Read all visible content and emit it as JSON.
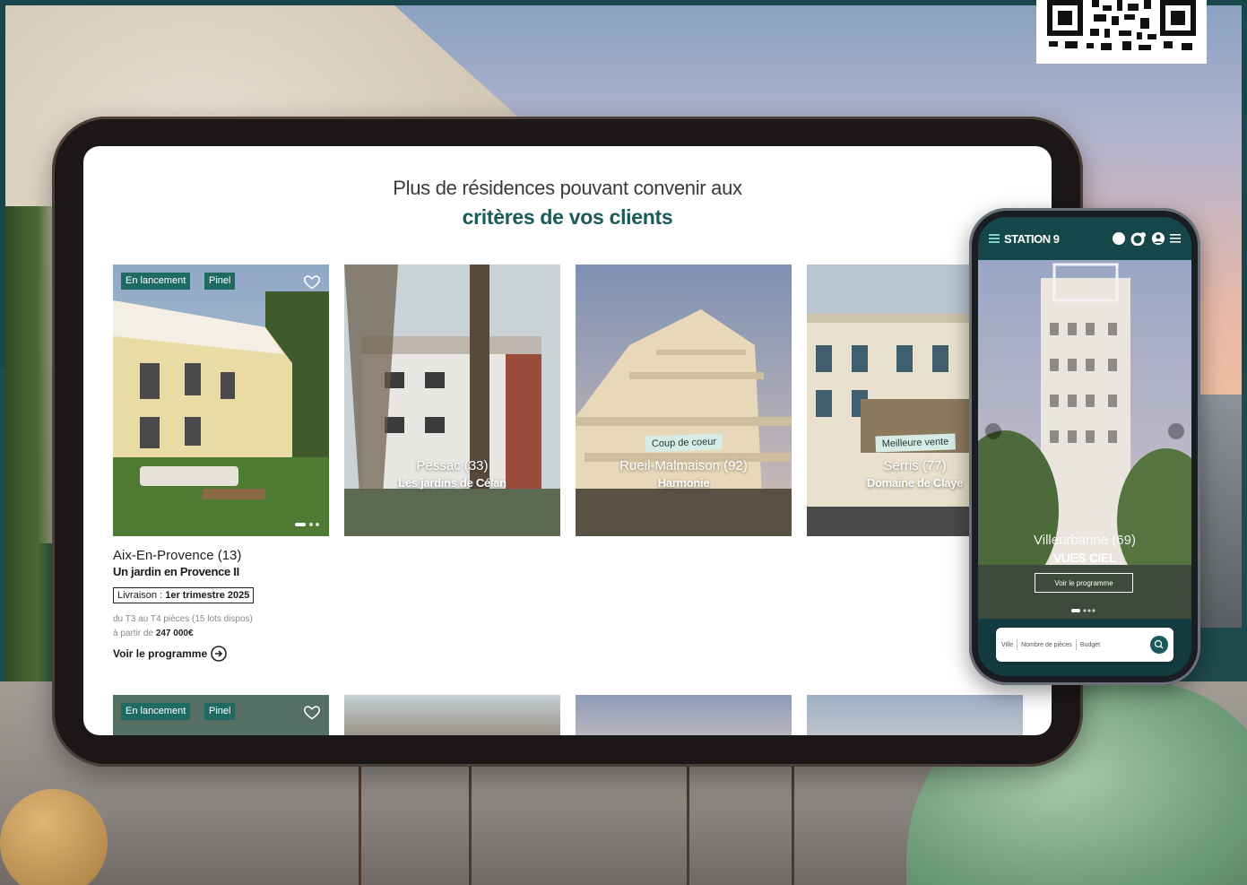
{
  "section": {
    "heading_line1": "Plus de résidences pouvant convenir aux",
    "heading_line2": "critères de vos clients"
  },
  "cards": [
    {
      "tags": [
        "En lancement",
        "Pinel"
      ],
      "city": "Aix-En-Provence (13)",
      "name": "Un jardin en Provence II",
      "delivery_label": "Livraison : ",
      "delivery_value": "1er trimestre 2025",
      "rooms": "du T3 au T4 pièces (15 lots dispos)",
      "price_prefix": "à partir de ",
      "price": "247 000€",
      "cta": "Voir le programme"
    },
    {
      "city": "Pessac (33)",
      "name": "Les jardins de Célan"
    },
    {
      "badge": "Coup de coeur",
      "city": "Rueil-Malmaison (92)",
      "name": "Harmonie"
    },
    {
      "badge": "Meilleure vente",
      "city": "Serris (77)",
      "name": "Domaine de Claye"
    }
  ],
  "second_row": {
    "tags": [
      "En lancement",
      "Pinel"
    ]
  },
  "phone": {
    "brand": "STATION 9",
    "hero_city": "Villeurbanne (69)",
    "hero_name": "VUES CIEL",
    "hero_cta": "Voir le programme",
    "search": {
      "city_placeholder": "Ville",
      "rooms_placeholder": "Nombre de pièces",
      "budget_placeholder": "Budget"
    }
  },
  "colors": {
    "brand_teal": "#1b5a5b",
    "tag_green": "#1f6b63",
    "badge_mint": "#d9ebe5"
  }
}
